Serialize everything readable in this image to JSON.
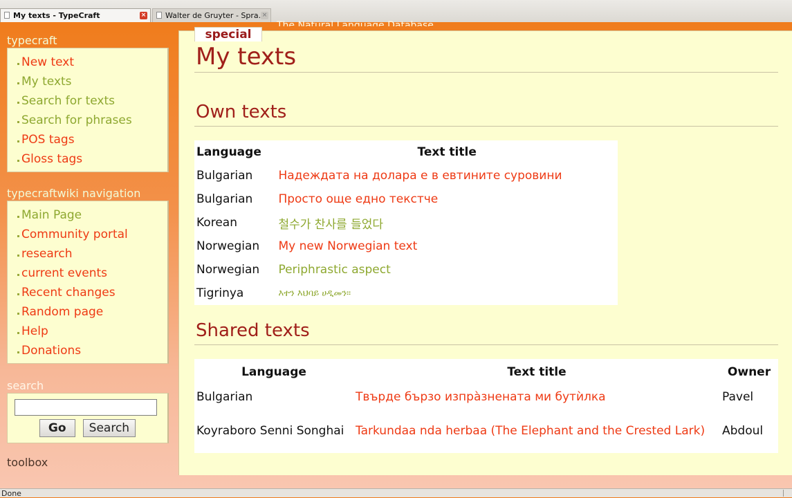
{
  "browser": {
    "tabs": [
      {
        "label": "My texts - TypeCraft",
        "active": true
      },
      {
        "label": "Walter de Gruyter - Spra...",
        "active": false
      }
    ],
    "status": "Done"
  },
  "site": {
    "name": "The Natural Language Database",
    "special_tab": "special"
  },
  "sidebar": {
    "typecraft": {
      "title": "typecraft",
      "items": [
        {
          "label": "New text",
          "color": "#ee3a14"
        },
        {
          "label": "My texts",
          "color": "#8ea830"
        },
        {
          "label": "Search for texts",
          "color": "#8ea830"
        },
        {
          "label": "Search for phrases",
          "color": "#8ea830"
        },
        {
          "label": "POS tags",
          "color": "#ee3a14"
        },
        {
          "label": "Gloss tags",
          "color": "#ee3a14"
        }
      ]
    },
    "wiki": {
      "title": "typecraftwiki navigation",
      "items": [
        {
          "label": "Main Page",
          "color": "#8ea830"
        },
        {
          "label": "Community portal",
          "color": "#ee3a14"
        },
        {
          "label": "research",
          "color": "#ee3a14"
        },
        {
          "label": "current events",
          "color": "#ee3a14"
        },
        {
          "label": "Recent changes",
          "color": "#ee3a14"
        },
        {
          "label": "Random page",
          "color": "#ee3a14"
        },
        {
          "label": "Help",
          "color": "#ee3a14"
        },
        {
          "label": "Donations",
          "color": "#ee3a14"
        }
      ]
    },
    "search": {
      "title": "search",
      "input_value": "",
      "go_label": "Go",
      "search_label": "Search"
    },
    "toolbox": {
      "title": "toolbox"
    }
  },
  "main": {
    "title": "My texts",
    "own": {
      "heading": "Own texts",
      "columns": [
        "Language",
        "Text title"
      ],
      "rows": [
        {
          "language": "Bulgarian",
          "title": "Надеждата на долара е в евтините суровини",
          "color": "#ee3a14"
        },
        {
          "language": "Bulgarian",
          "title": "Просто още едно текстче",
          "color": "#ee3a14"
        },
        {
          "language": "Korean",
          "title": "철수가 찬사를 들었다",
          "color": "#8ea830"
        },
        {
          "language": "Norwegian",
          "title": "My new Norwegian text",
          "color": "#ee3a14"
        },
        {
          "language": "Norwegian",
          "title": "Periphrastic aspect",
          "color": "#8ea830"
        },
        {
          "language": "Tigrinya",
          "title": "እተን እህባይ ሀዲመን።",
          "color": "#8ea830"
        }
      ]
    },
    "shared": {
      "heading": "Shared texts",
      "columns": [
        "Language",
        "Text title",
        "Owner"
      ],
      "rows": [
        {
          "language": "Bulgarian",
          "title": "Твърде бързо изпра̀знената ми бутѝлка",
          "owner": "Pavel",
          "color": "#ee3a14"
        },
        {
          "language": "Koyraboro Senni Songhai",
          "title": "Tarkundaa nda herbaa (The Elephant and the Crested Lark)",
          "owner": "Abdoul",
          "color": "#ee3a14"
        }
      ]
    }
  }
}
